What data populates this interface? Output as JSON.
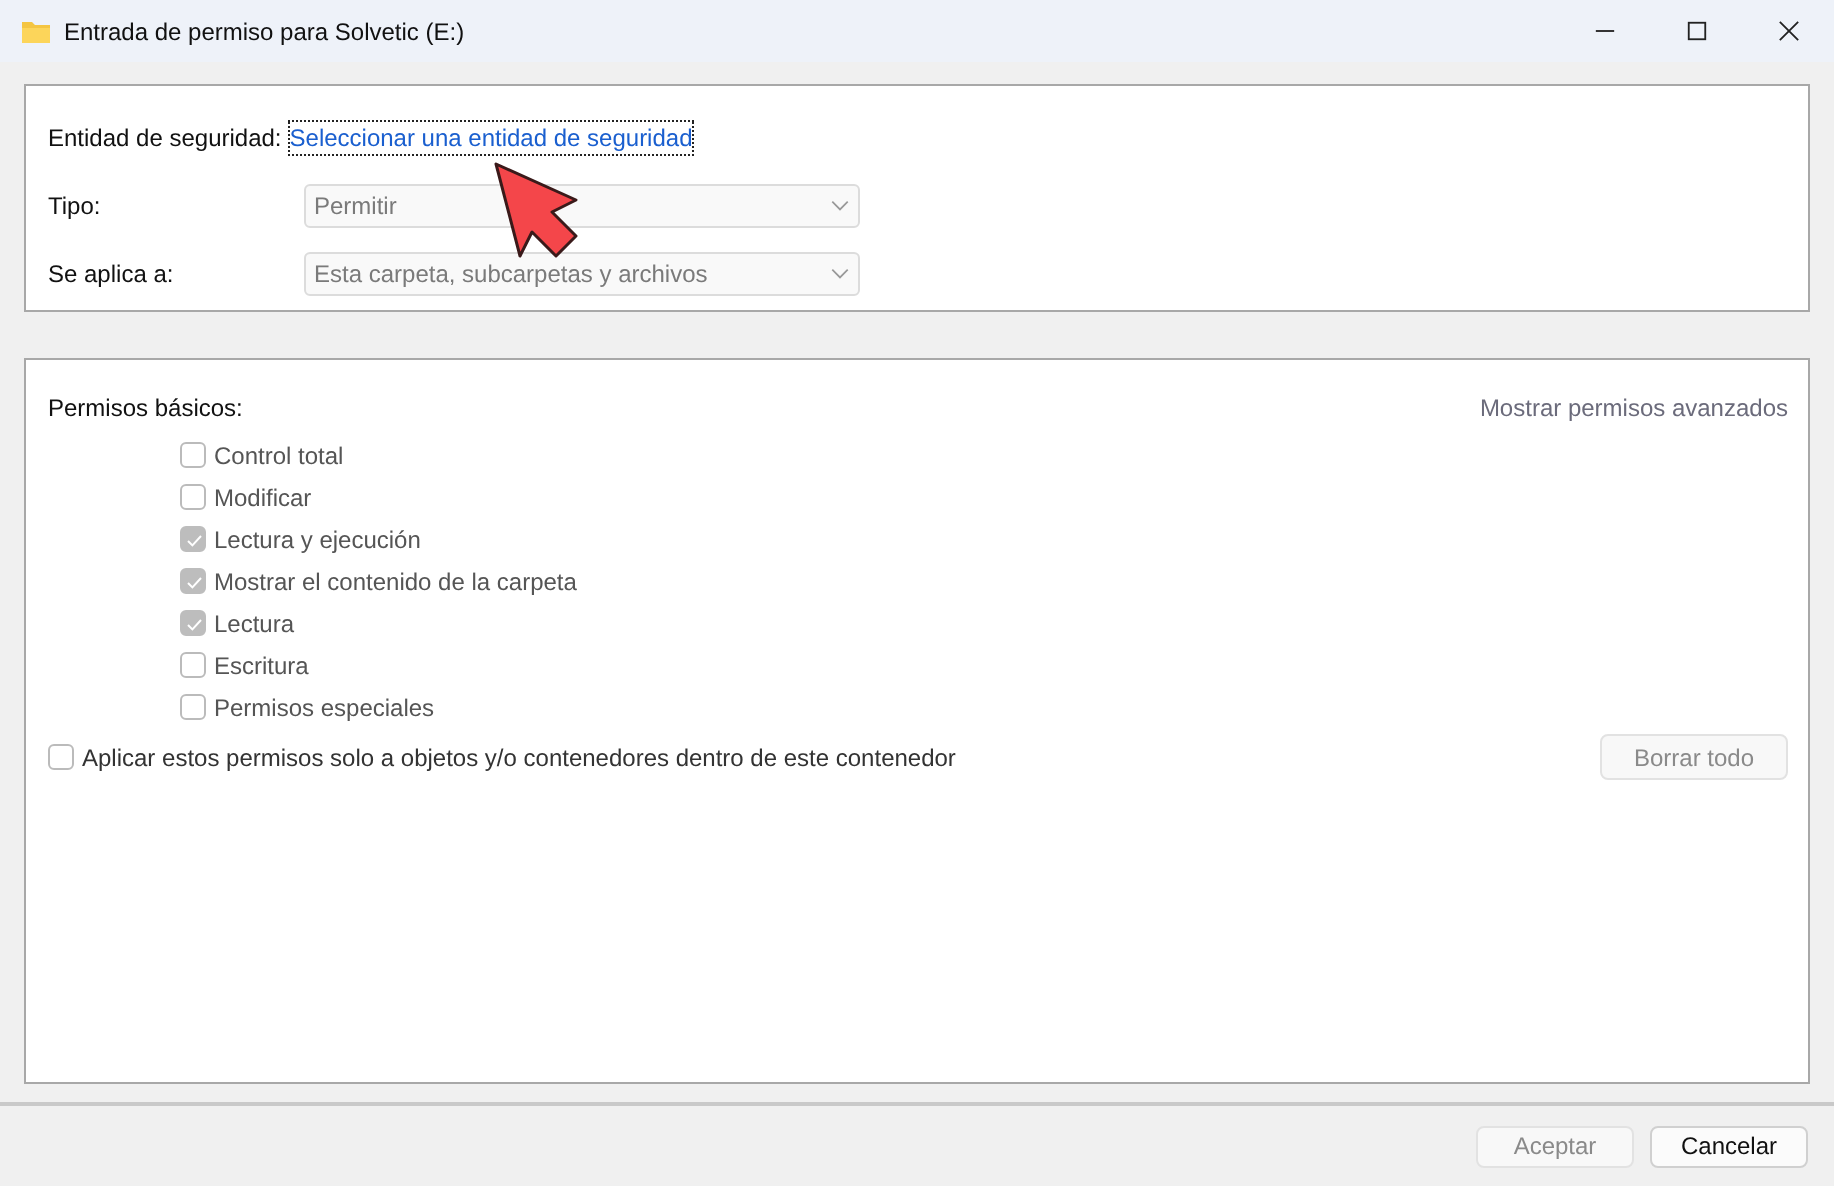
{
  "window": {
    "title": "Entrada de permiso para Solvetic (E:)"
  },
  "principal": {
    "label": "Entidad de seguridad:",
    "link": "Seleccionar una entidad de seguridad",
    "focused": true
  },
  "fields": [
    {
      "label": "Tipo:",
      "value": "Permitir",
      "disabled": true
    },
    {
      "label": "Se aplica a:",
      "value": "Esta carpeta, subcarpetas y archivos",
      "disabled": true
    }
  ],
  "permissions": {
    "title": "Permisos básicos:",
    "advanced_link": "Mostrar permisos avanzados",
    "items": [
      {
        "label": "Control total",
        "checked": false
      },
      {
        "label": "Modificar",
        "checked": false
      },
      {
        "label": "Lectura y ejecución",
        "checked": true
      },
      {
        "label": "Mostrar el contenido de la carpeta",
        "checked": true
      },
      {
        "label": "Lectura",
        "checked": true
      },
      {
        "label": "Escritura",
        "checked": false
      },
      {
        "label": "Permisos especiales",
        "checked": false
      }
    ],
    "apply_only": {
      "label": "Aplicar estos permisos solo a objetos y/o contenedores dentro de este contenedor",
      "checked": false
    },
    "clear_button": {
      "label": "Borrar todo",
      "disabled": true
    }
  },
  "buttons": [
    {
      "label": "Aceptar",
      "disabled": true
    },
    {
      "label": "Cancelar",
      "disabled": false
    }
  ]
}
